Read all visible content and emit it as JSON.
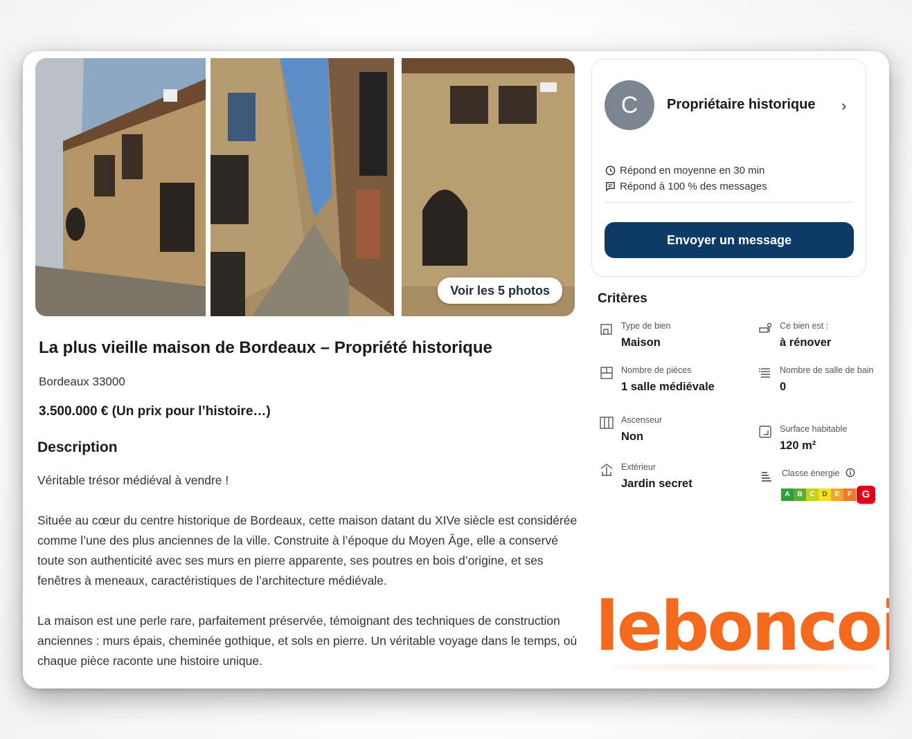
{
  "gallery": {
    "more_photos_label": "Voir les 5 photos"
  },
  "listing": {
    "title": "La plus vieille maison de Bordeaux – Propriété historique",
    "location": "Bordeaux 33000",
    "price": "3.500.000 € (Un prix pour l’histoire…)"
  },
  "description": {
    "heading": "Description",
    "paragraphs": [
      "Véritable trésor médiéval à vendre !",
      "Située au cœur du centre historique de Bordeaux, cette maison datant du XIVe siècle est considérée comme l’une des plus anciennes de la ville. Construite à l’époque du Moyen Âge, elle a conservé toute son authenticité avec ses murs en pierre apparente, ses poutres en bois d’origine, et ses fenêtres à meneaux, caractéristiques de l’architecture médiévale.",
      "La maison est une perle rare, parfaitement préservée, témoignant des techniques de construction anciennes : murs épais, cheminée gothique, et sols en pierre. Un véritable voyage dans le temps, où chaque pièce raconte une histoire unique."
    ]
  },
  "seller": {
    "avatar_letter": "C",
    "name": "Propriétaire historique",
    "response_time": "Répond en moyenne en 30 min",
    "response_rate": "Répond à 100 % des messages",
    "message_button": "Envoyer un message"
  },
  "criteria": {
    "title": "Critères",
    "items": [
      {
        "icon": "house-type-icon",
        "label": "Type de bien",
        "value": "Maison"
      },
      {
        "icon": "renovation-icon",
        "label": "Ce bien est :",
        "value": "à rénover"
      },
      {
        "icon": "rooms-icon",
        "label": "Nombre de pièces",
        "value": "1 salle médiévale"
      },
      {
        "icon": "bathroom-icon",
        "label": "Nombre de salle de bain",
        "value": "0"
      },
      {
        "icon": "elevator-icon",
        "label": "Ascenseur",
        "value": "Non"
      },
      {
        "icon": "surface-icon",
        "label": "Surface habitable",
        "value": "120 m²"
      },
      {
        "icon": "outdoor-icon",
        "label": "Extérieur",
        "value": "Jardin secret"
      },
      {
        "icon": "energy-icon",
        "label": "Classe énergie",
        "value": "G"
      }
    ],
    "energy_scale": {
      "letters": [
        "A",
        "B",
        "C",
        "D",
        "E",
        "F"
      ],
      "colors": [
        "#2e9e3f",
        "#58b030",
        "#c3d21a",
        "#f2df22",
        "#f3a52a",
        "#f0782a"
      ],
      "current": "G",
      "current_color": "#e3001b"
    }
  },
  "brand": {
    "logo_text": "leboncoin",
    "color": "#f36a1e"
  }
}
